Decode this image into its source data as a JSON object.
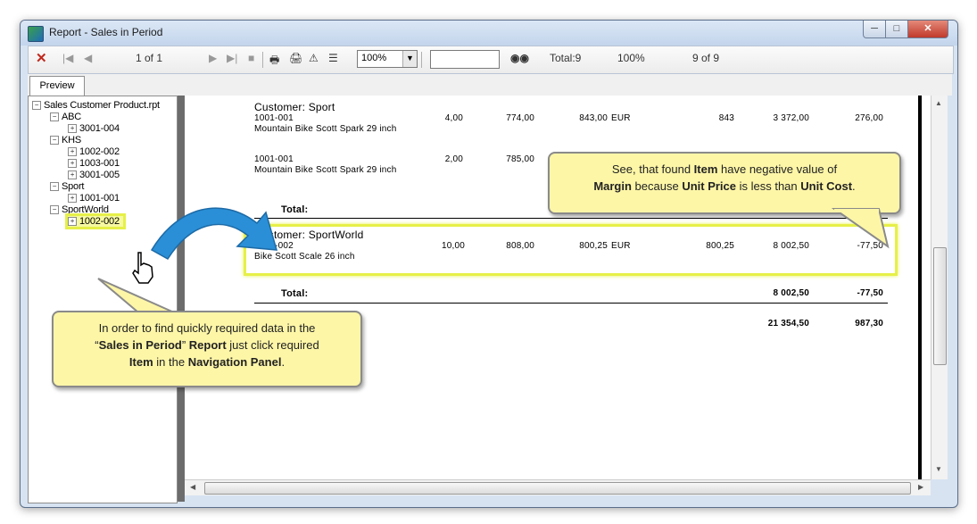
{
  "window": {
    "title": "Report - Sales in Period"
  },
  "toolbar": {
    "page_indicator": "1 of 1",
    "zoom": "100%",
    "total": "Total:9",
    "percent": "100%",
    "position": "9 of 9"
  },
  "tabs": {
    "preview": "Preview"
  },
  "tree": {
    "root": "Sales Customer Product.rpt",
    "nodes": [
      "ABC",
      "3001-004",
      "KHS",
      "1002-002",
      "1003-001",
      "3001-005",
      "Sport",
      "1001-001",
      "SportWorld",
      "1002-002"
    ]
  },
  "report": {
    "cust1_label": "Customer:",
    "cust1_name": "Sport",
    "row1": {
      "code": "1001-001",
      "desc": "Mountain Bike Scott Spark 29 inch",
      "qty": "4,00",
      "cost": "774,00",
      "price": "843,00",
      "cur": "EUR",
      "price2": "843",
      "amount": "3 372,00",
      "margin": "276,00"
    },
    "row2": {
      "code": "1001-001",
      "desc": "Mountain Bike Scott Spark 29 inch",
      "qty": "2,00",
      "cost": "785,00"
    },
    "total1_label": "Total:",
    "cust2_label": "Customer:",
    "cust2_name": "SportWorld",
    "row3": {
      "code": "1002-002",
      "desc": "Bike Scott Scale 26 inch",
      "qty": "10,00",
      "cost": "808,00",
      "price": "800,25",
      "cur": "EUR",
      "price2": "800,25",
      "amount": "8 002,50",
      "margin": "-77,50"
    },
    "total2_label": "Total:",
    "total2_amount": "8 002,50",
    "total2_margin": "-77,50",
    "grand_amount": "21 354,50",
    "grand_margin": "987,30"
  },
  "callouts": {
    "right": {
      "l1a": "See, that found ",
      "l1b": "Item",
      "l1c": " have negative value of",
      "l2a": "Margin",
      "l2b": " because ",
      "l2c": "Unit Price",
      "l2d": " is less than ",
      "l2e": "Unit Cost",
      "l2f": "."
    },
    "left": {
      "l1": "In order to find quickly required data in the",
      "l2a": "“",
      "l2b": "Sales in Period",
      "l2c": "” ",
      "l2d": "Report",
      "l2e": " just click required",
      "l3a": "Item",
      "l3b": " in the ",
      "l3c": "Navigation Panel",
      "l3d": "."
    }
  },
  "colors": {
    "highlight": "#e6f048",
    "callout_bg": "#fdf6a7",
    "arrow": "#2a8fd6",
    "close_x": "#c0281c"
  }
}
